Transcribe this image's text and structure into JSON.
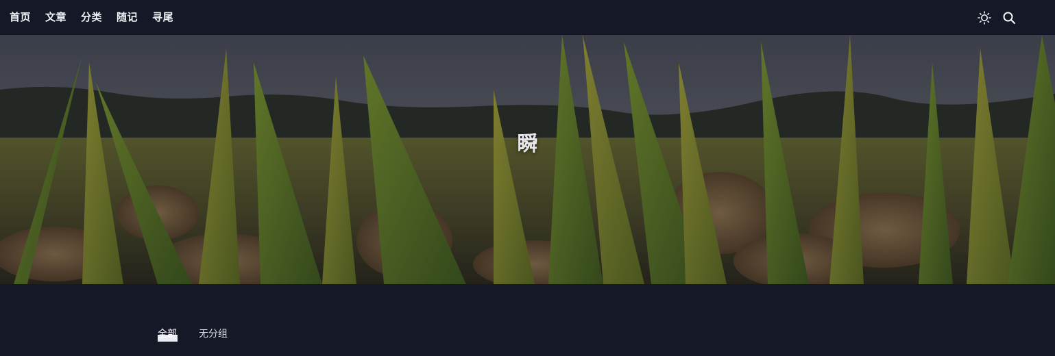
{
  "nav": {
    "items": [
      {
        "label": "首页"
      },
      {
        "label": "文章"
      },
      {
        "label": "分类"
      },
      {
        "label": "随记"
      },
      {
        "label": "寻尾"
      }
    ]
  },
  "tools": {
    "theme_icon": "sun-icon",
    "search_icon": "search-icon"
  },
  "hero": {
    "title": "瞬"
  },
  "tabs": [
    {
      "label": "全部",
      "active": true
    },
    {
      "label": "无分组",
      "active": false
    }
  ],
  "colors": {
    "background": "#141827",
    "text": "#f1f3f7"
  }
}
